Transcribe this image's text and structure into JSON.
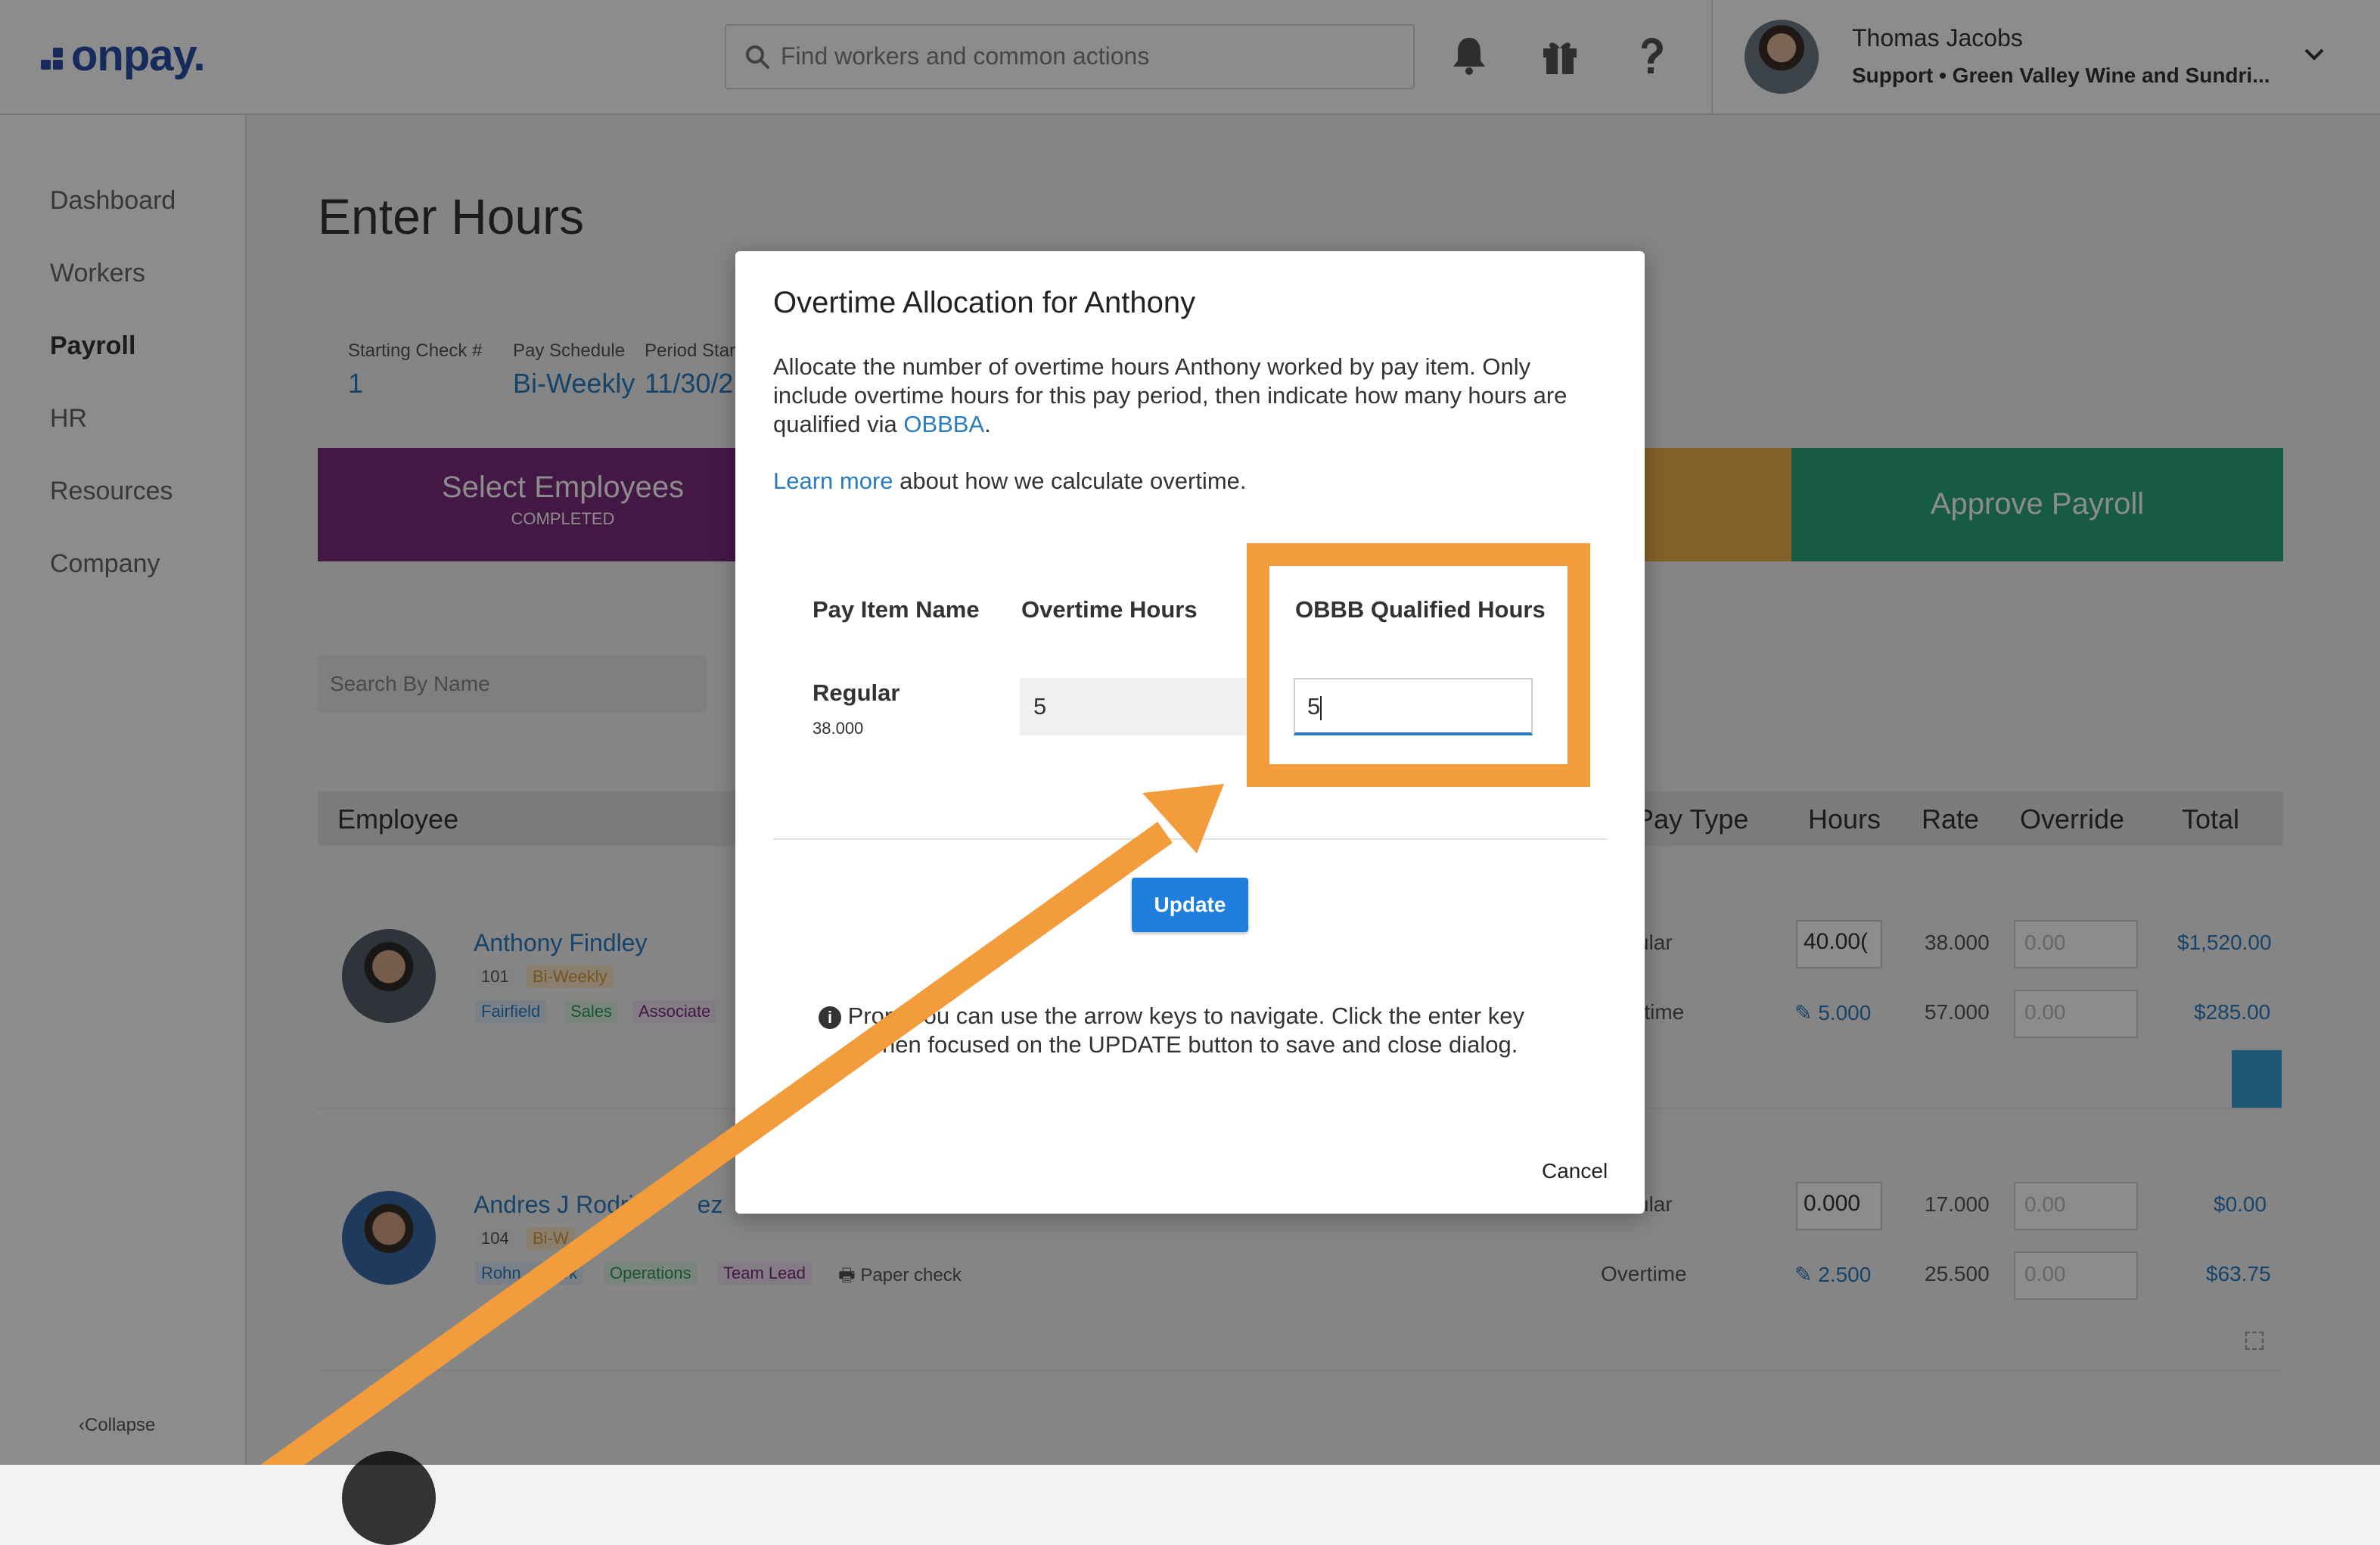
{
  "header": {
    "logo_text": "onpay.",
    "search_placeholder": "Find workers and common actions",
    "user_name": "Thomas Jacobs",
    "user_subtitle": "Support • Green Valley Wine and Sundri..."
  },
  "sidebar": {
    "items": [
      {
        "label": "Dashboard"
      },
      {
        "label": "Workers"
      },
      {
        "label": "Payroll"
      },
      {
        "label": "HR"
      },
      {
        "label": "Resources"
      },
      {
        "label": "Company"
      }
    ],
    "collapse_label": "Collapse"
  },
  "page": {
    "title": "Enter Hours",
    "meta": {
      "starting_check_label": "Starting Check #",
      "starting_check_value": "1",
      "pay_schedule_label": "Pay Schedule",
      "pay_schedule_value": "Bi-Weekly",
      "period_start_label": "Period Star",
      "period_start_value": "11/30/2"
    },
    "steps": {
      "select_employees": "Select Employees",
      "select_employees_status": "COMPLETED",
      "approve_payroll": "Approve Payroll"
    },
    "search_by_name_placeholder": "Search By Name",
    "table_headers": {
      "employee": "Employee",
      "pay_type": "Pay Type",
      "hours": "Hours",
      "rate": "Rate",
      "override": "Override",
      "total": "Total"
    },
    "employees": [
      {
        "name": "Anthony Findley",
        "id": "101",
        "schedule": "Bi-Weekly",
        "tags": [
          "Fairfield",
          "Sales",
          "Associate"
        ],
        "rows": [
          {
            "pay_type": "ular",
            "hours": "40.00(",
            "rate": "38.000",
            "override": "0.00",
            "total": "$1,520.00"
          },
          {
            "pay_type": "rtime",
            "hours": "5.000",
            "rate": "57.000",
            "override": "0.00",
            "total": "$285.00"
          }
        ]
      },
      {
        "name_visible_start": "Andres J Rodri",
        "name_visible_end": "ez",
        "id": "104",
        "schedule": "Bi-W",
        "tags_start": "Rohn",
        "tags_end": "ark",
        "tags": [
          "Operations",
          "Team Lead"
        ],
        "paper_check": "Paper check",
        "rows": [
          {
            "pay_type": "ular",
            "hours": "0.000",
            "rate": "17.000",
            "override": "0.00",
            "total": "$0.00"
          },
          {
            "pay_type": "Overtime",
            "hours": "2.500",
            "rate": "25.500",
            "override": "0.00",
            "total": "$63.75"
          }
        ]
      }
    ]
  },
  "dialog": {
    "title": "Overtime Allocation for Anthony",
    "body_text": "Allocate the number of overtime hours Anthony worked by pay item. Only include overtime hours for this pay period, then indicate how many hours are qualified via ",
    "obbba_link": "OBBBA",
    "body_end": ".",
    "learn_more_link": "Learn more",
    "learn_more_rest": " about how we calculate overtime.",
    "columns": {
      "pay_item_name": "Pay Item Name",
      "overtime_hours": "Overtime Hours",
      "obbb_qualified_hours": "OBBB Qualified Hours"
    },
    "item": {
      "name": "Regular",
      "rate": "38.000",
      "overtime_hours": "5",
      "obbb_qualified_hours": "5"
    },
    "update_label": "Update",
    "tip_start": "Pro",
    "tip_line1": "p. You can use the arrow keys to navigate. Click the enter key",
    "tip_line2": "hen focused on the UPDATE button to save and close dialog.",
    "cancel_label": "Cancel"
  },
  "colors": {
    "accent_blue": "#2a7cc1",
    "step_purple": "#7b2d7f",
    "step_green": "#2aa67b",
    "annotation_orange": "#f39c3c"
  }
}
